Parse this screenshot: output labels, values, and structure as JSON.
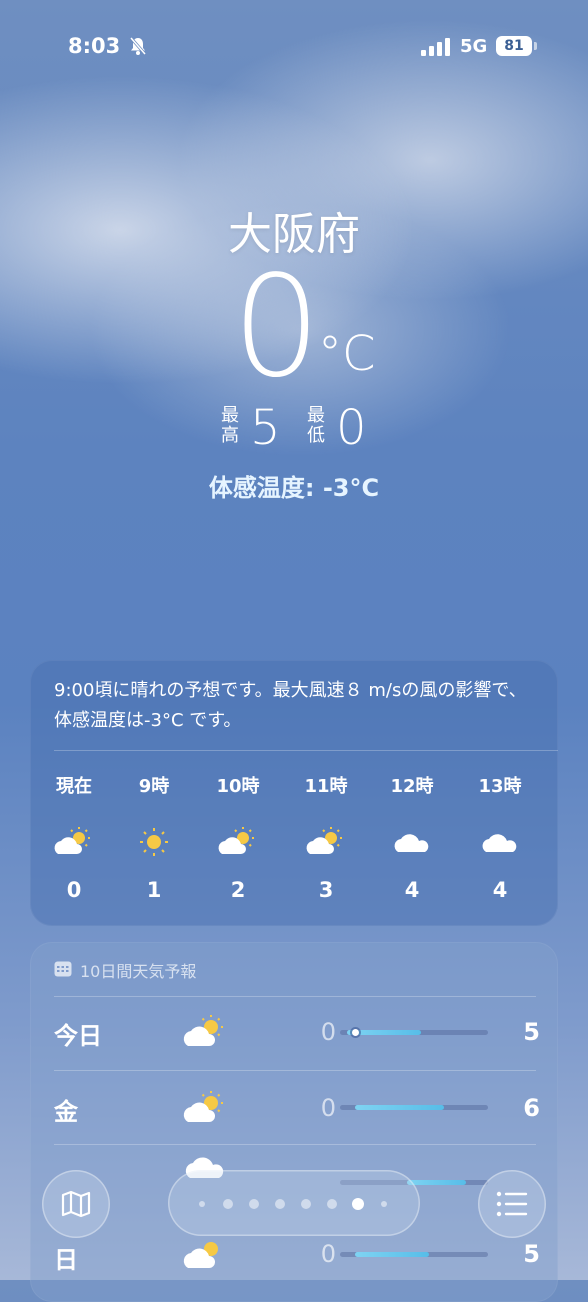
{
  "status": {
    "time": "8:03",
    "network": "5G",
    "battery": "81",
    "icons": [
      "bell-slash-icon",
      "signal-icon",
      "battery-icon"
    ]
  },
  "hero": {
    "city": "大阪府",
    "temp": "0",
    "unit": "°C",
    "high_label": "最\n高",
    "high": "5",
    "low_label": "最\n低",
    "low": "0",
    "feels_like": "体感温度: -3°C"
  },
  "hourly": {
    "summary": "9:00頃に晴れの予想です。最大風速８ m/sの風の影響で、体感温度は-3°C です。",
    "items": [
      {
        "label": "現在",
        "icon": "partly-sunny-icon",
        "temp": "0"
      },
      {
        "label": "9時",
        "icon": "sun-icon",
        "temp": "1"
      },
      {
        "label": "10時",
        "icon": "partly-sunny-icon",
        "temp": "2"
      },
      {
        "label": "11時",
        "icon": "partly-sunny-icon",
        "temp": "3"
      },
      {
        "label": "12時",
        "icon": "cloud-icon",
        "temp": "4"
      },
      {
        "label": "13時",
        "icon": "cloud-icon",
        "temp": "4"
      }
    ]
  },
  "tenday": {
    "title": "10日間天気予報",
    "rows": [
      {
        "day": "今日",
        "icon": "partly-sunny-icon",
        "low": "0",
        "high": "5",
        "range_start": 0.05,
        "range_end": 0.55,
        "current": 0.1
      },
      {
        "day": "金",
        "icon": "partly-sunny-icon",
        "low": "0",
        "high": "6",
        "range_start": 0.1,
        "range_end": 0.7
      },
      {
        "day": "",
        "icon": "cloud-icon",
        "low": "",
        "high": "",
        "range_start": 0.45,
        "range_end": 0.85
      },
      {
        "day": "日",
        "icon": "partly-sunny-icon",
        "low": "0",
        "high": "5",
        "range_start": 0.1,
        "range_end": 0.6
      }
    ]
  },
  "toolbar": {
    "page_count": 8,
    "active_page": 6
  },
  "colors": {
    "accent": "#57bde8",
    "sun": "#f6c945",
    "card": "#466eaf"
  }
}
